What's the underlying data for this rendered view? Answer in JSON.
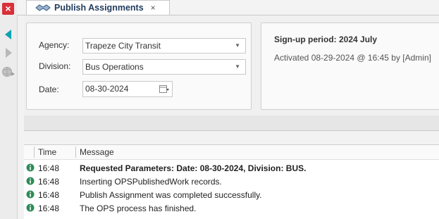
{
  "tab": {
    "title": "Publish Assignments",
    "close": "×"
  },
  "rail": {
    "close_label": "×"
  },
  "form": {
    "agency_label": "Agency:",
    "agency_value": "Trapeze City Transit",
    "division_label": "Division:",
    "division_value": "Bus Operations",
    "date_label": "Date:",
    "date_value": "08-30-2024"
  },
  "signup": {
    "title": "Sign-up period: 2024 July",
    "activated": "Activated 08-29-2024 @ 16:45 by [Admin]"
  },
  "log": {
    "time_header": "Time",
    "message_header": "Message",
    "rows": [
      {
        "time": "16:48",
        "message": "Requested Parameters: Date: 08-30-2024, Division: BUS."
      },
      {
        "time": "16:48",
        "message": "Inserting OPSPublishedWork records."
      },
      {
        "time": "16:48",
        "message": "Publish Assignment was completed successfully."
      },
      {
        "time": "16:48",
        "message": "The OPS process has finished."
      }
    ]
  },
  "colors": {
    "accent_teal": "#0fa3b1",
    "close_red": "#d9303a",
    "info_green": "#2e8b57"
  },
  "icons": [
    "close-icon",
    "arrow-left-icon",
    "arrow-right-icon",
    "globe-icon",
    "handshake-icon",
    "calendar-icon",
    "chevron-down-icon",
    "info-icon"
  ]
}
